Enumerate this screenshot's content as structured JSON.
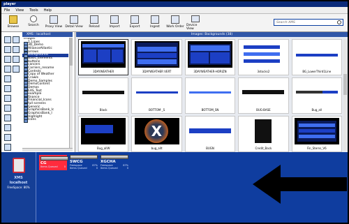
{
  "window": {
    "title": "player"
  },
  "menu": [
    "File",
    "View",
    "Tools",
    "Help"
  ],
  "toolbar": [
    {
      "label": "Browse",
      "icon": "folder-icon"
    },
    {
      "label": "Search",
      "icon": "search-icon"
    },
    {
      "label": "Proxy View",
      "icon": "proxy-view-icon"
    },
    {
      "label": "Detail View",
      "icon": "detail-view-icon"
    },
    {
      "label": "Reload",
      "icon": "reload-icon"
    },
    {
      "label": "Import",
      "icon": "import-icon"
    },
    {
      "label": "Export",
      "icon": "export-icon"
    },
    {
      "label": "Ingest",
      "icon": "ingest-icon"
    },
    {
      "label": "Work Order",
      "icon": "work-order-icon"
    },
    {
      "label": "Device View",
      "icon": "device-view-icon"
    }
  ],
  "search": {
    "placeholder": "Search XMS"
  },
  "tree": {
    "header": "XMS : localhost",
    "items": [
      {
        "label": "Images",
        "root": true
      },
      {
        "label": "1_Lines"
      },
      {
        "label": "3D_Demo"
      },
      {
        "label": "AllianceAtlantic"
      },
      {
        "label": "arrows"
      },
      {
        "label": "Backgrounds",
        "selected": true
      },
      {
        "label": "Basic_Elements"
      },
      {
        "label": "buttons"
      },
      {
        "label": "cancers"
      },
      {
        "label": "Carriers_rename"
      },
      {
        "label": "Controls"
      },
      {
        "label": "Copy of Weather"
      },
      {
        "label": "Crawls"
      },
      {
        "label": "Demo_Samples"
      },
      {
        "label": "DemoContent"
      },
      {
        "label": "Demos"
      },
      {
        "label": "EAS_Test"
      },
      {
        "label": "example"
      },
      {
        "label": "finance"
      },
      {
        "label": "Financial_Icons"
      },
      {
        "label": "full screens"
      },
      {
        "label": "Generic"
      },
      {
        "label": "GraphicsBank_Ic"
      },
      {
        "label": "GraphicsBank_I"
      },
      {
        "label": "Highlight"
      },
      {
        "label": "Icons"
      }
    ]
  },
  "main": {
    "header": "Images: Backgrounds (38)",
    "items": [
      {
        "label": "3DAYWEATHER",
        "style": "weather"
      },
      {
        "label": "3DAYWEATHER VERT",
        "style": "weather-vert"
      },
      {
        "label": "3DAYWEATHER-HORIZN",
        "style": "weather-horiz"
      },
      {
        "label": "3stocks2",
        "style": "stocks"
      },
      {
        "label": "BG_LowerThird1Line",
        "style": "lowerthird"
      },
      {
        "label": "Black",
        "style": "black-bar"
      },
      {
        "label": "BOTTOM _S",
        "style": "bottom-s"
      },
      {
        "label": "BOTTOM_SN",
        "style": "bottom-sn"
      },
      {
        "label": "BUG-BASE",
        "style": "bug-base"
      },
      {
        "label": "Bug_all",
        "style": "bug-all"
      },
      {
        "label": "Bug_allW",
        "style": "bug-allw"
      },
      {
        "label": "bug_allt",
        "style": "bug-x"
      },
      {
        "label": "BUGN",
        "style": "bugn"
      },
      {
        "label": "Credit_Back",
        "style": "credit"
      },
      {
        "label": "Fin_Sterns_V6",
        "style": "fin"
      }
    ]
  },
  "status": {
    "host_label": "XMS",
    "host_name": "localhost",
    "free_space": "FreeSpace: 86%"
  },
  "servers": [
    {
      "name": "CG",
      "active": true,
      "free_label": "",
      "free_value": "",
      "queued_label": "Items Queued",
      "queued_value": "0"
    },
    {
      "name": "SWCG",
      "active": false,
      "free_label": "Freespace",
      "free_value": "87%",
      "queued_label": "Items Queued",
      "queued_value": "0"
    },
    {
      "name": "XGCHA",
      "active": false,
      "free_label": "Freespace",
      "free_value": "87%",
      "queued_label": "Items Queued",
      "queued_value": "0"
    }
  ],
  "colors": {
    "accent": "#0f3d9f",
    "header": "#3056a8",
    "active_server": "#ff2b3d"
  }
}
